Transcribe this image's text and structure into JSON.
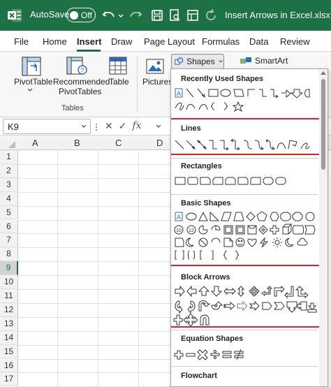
{
  "titlebar": {
    "autosave_label": "AutoSave",
    "autosave_state": "Off",
    "document_title": "Insert Arrows in Excel.xlsx"
  },
  "menu": [
    "File",
    "Home",
    "Insert",
    "Draw",
    "Page Layout",
    "Formulas",
    "Data",
    "Review"
  ],
  "ribbon": {
    "pivottable": "PivotTable",
    "recommended_line1": "Recommended",
    "recommended_line2": "PivotTables",
    "table": "Table",
    "group_tables": "Tables",
    "pictures": "Pictures",
    "shapes": "Shapes",
    "smartart": "SmartArt"
  },
  "formula_bar": {
    "name_box": "K9",
    "fx": "fx"
  },
  "columns": [
    "A",
    "B",
    "C",
    "D"
  ],
  "rows": [
    "1",
    "2",
    "3",
    "4",
    "5",
    "6",
    "7",
    "8",
    "9",
    "10",
    "11",
    "12",
    "13",
    "14",
    "15",
    "16",
    "17"
  ],
  "selected_row": "9",
  "shapes_panel": {
    "categories": [
      "Recently Used Shapes",
      "Lines",
      "Rectangles",
      "Basic Shapes",
      "Block Arrows",
      "Equation Shapes",
      "Flowchart"
    ],
    "highlighted": [
      "Lines",
      "Block Arrows"
    ]
  },
  "colors": {
    "excel_green": "#1e7145",
    "highlight_red": "#d9262e"
  }
}
